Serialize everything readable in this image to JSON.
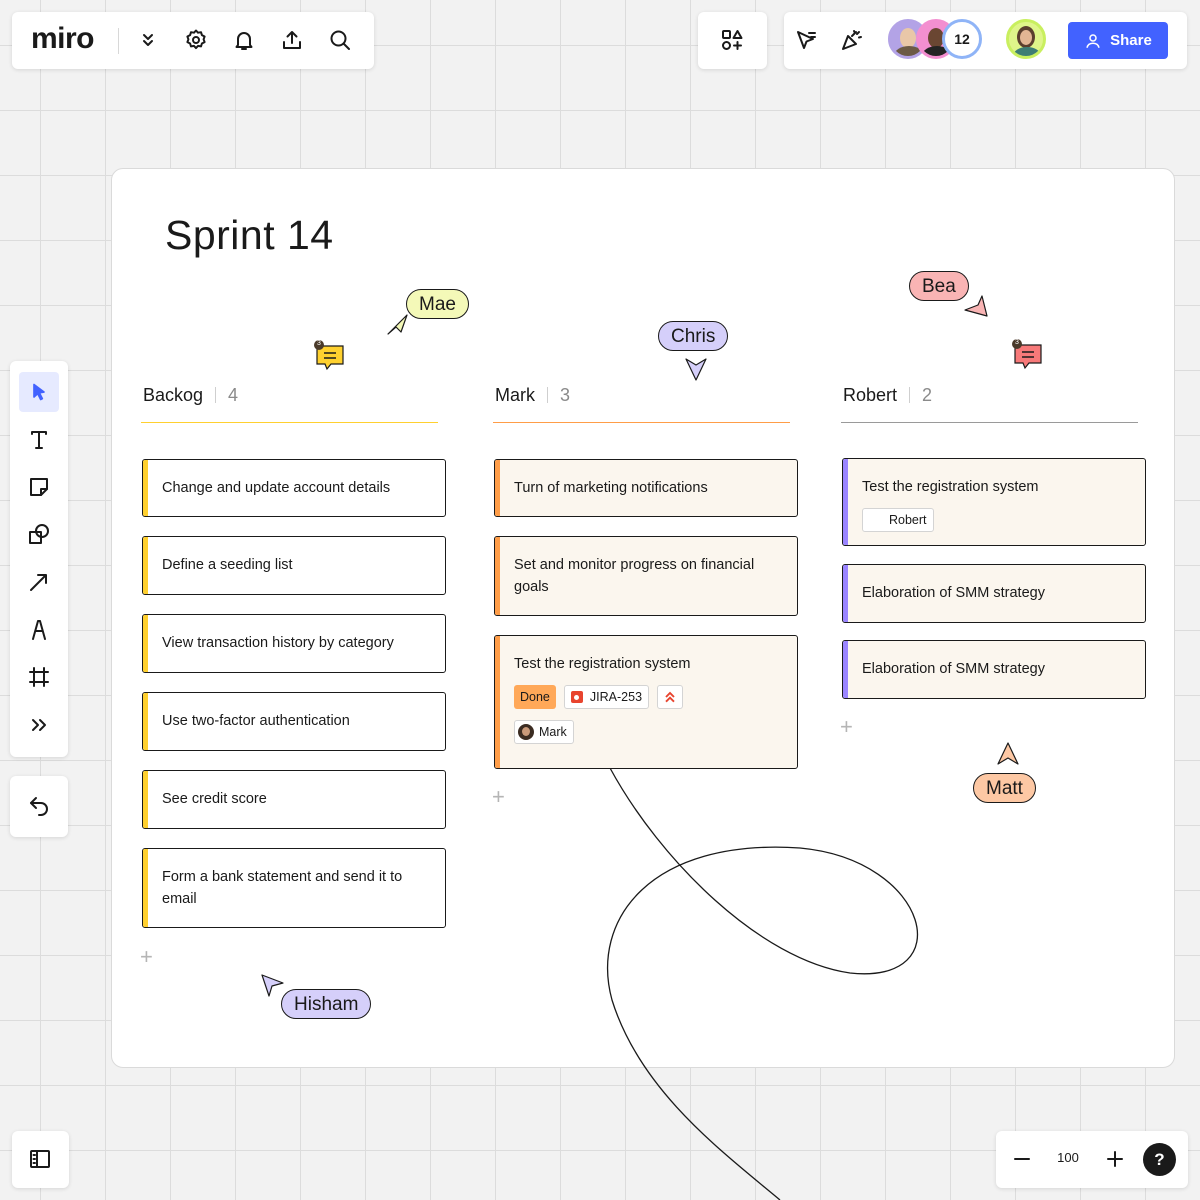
{
  "app": {
    "logo": "miro",
    "top_icons": [
      "chevron-double-down-icon",
      "gear-icon",
      "bell-icon",
      "upload-icon",
      "search-icon"
    ],
    "right_icons": [
      "shapes-apps-icon",
      "cursor-select-icon",
      "celebrate-icon"
    ]
  },
  "collaborators": {
    "extra_count": "12",
    "share_label": "Share"
  },
  "frame": {
    "title": "Sprint 14"
  },
  "columns": [
    {
      "name": "Backog",
      "count": "4",
      "color": "#ffd02f",
      "cards": [
        {
          "text": "Change and update account details"
        },
        {
          "text": "Define a seeding list"
        },
        {
          "text": "View transaction history by category"
        },
        {
          "text": "Use two-factor authentication"
        },
        {
          "text": "See credit score"
        },
        {
          "text": "Form a bank statement and send it to email"
        }
      ]
    },
    {
      "name": "Mark",
      "count": "3",
      "color": "#ff9d48",
      "cards": [
        {
          "text": "Turn of marketing notifications"
        },
        {
          "text": "Set and monitor progress on financial goals"
        },
        {
          "text": "Test the registration system",
          "status": "Done",
          "ticket": "JIRA-253",
          "assignee": "Mark"
        }
      ]
    },
    {
      "name": "Robert",
      "count": "2",
      "color": "#9a9a9a",
      "cards": [
        {
          "text": "Test the registration system",
          "assignee": "Robert"
        },
        {
          "text": "Elaboration of SMM strategy"
        },
        {
          "text": "Elaboration of SMM strategy"
        }
      ]
    }
  ],
  "cursors": [
    {
      "name": "Mae",
      "color": "#f4f9b8"
    },
    {
      "name": "Chris",
      "color": "#d5cffa"
    },
    {
      "name": "Bea",
      "color": "#f9b4b4"
    },
    {
      "name": "Matt",
      "color": "#fdc8a4"
    },
    {
      "name": "Hisham",
      "color": "#d5cffa"
    }
  ],
  "comments": [
    {
      "count": "3",
      "color": "#ffd12f"
    },
    {
      "count": "3",
      "color": "#f77979"
    }
  ],
  "toolbar": {
    "tools": [
      "select-icon",
      "text-icon",
      "sticky-note-icon",
      "shapes-icon",
      "arrow-icon",
      "pen-icon",
      "frame-icon",
      "more-icon"
    ],
    "undo": "undo-icon"
  },
  "zoom": {
    "value": "100",
    "help": "?"
  }
}
